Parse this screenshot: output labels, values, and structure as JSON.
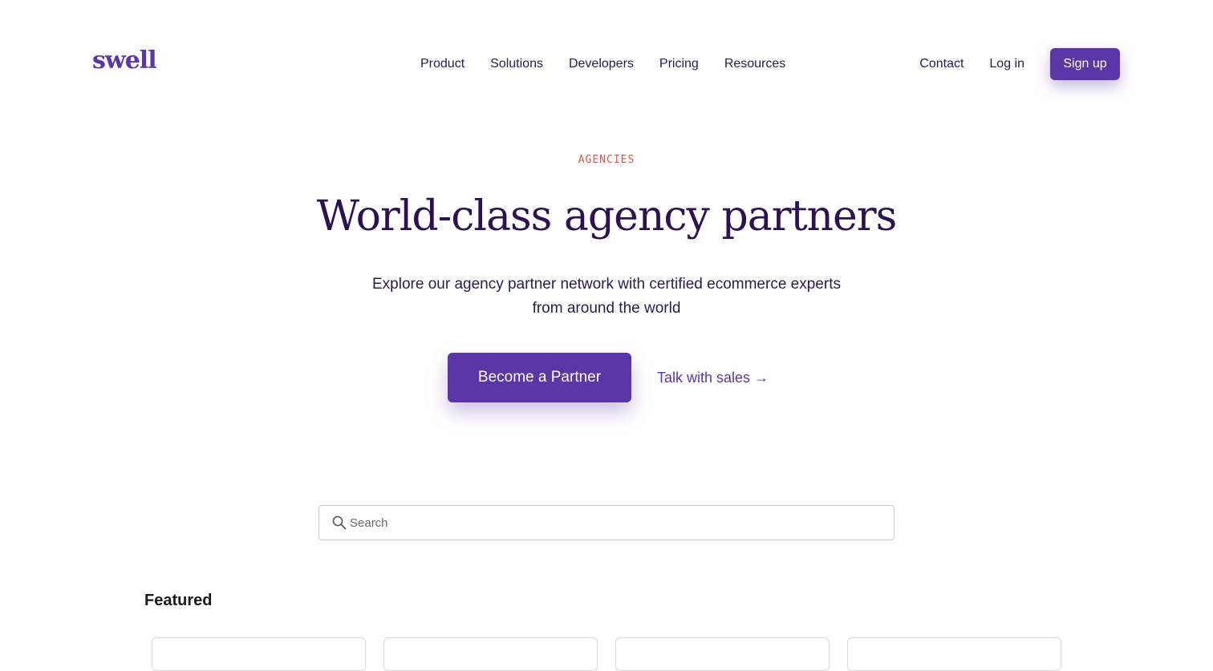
{
  "header": {
    "logo": "swell",
    "nav": [
      "Product",
      "Solutions",
      "Developers",
      "Pricing",
      "Resources"
    ],
    "contact": "Contact",
    "login": "Log in",
    "signup": "Sign up"
  },
  "hero": {
    "eyebrow": "AGENCIES",
    "title": "World-class agency partners",
    "subtitle_line1": "Explore our agency partner network with certified ecommerce experts",
    "subtitle_line2": "from around the world",
    "primary_cta": "Become a Partner",
    "secondary_cta": "Talk with sales →"
  },
  "search": {
    "placeholder": "Search"
  },
  "featured": {
    "title": "Featured"
  },
  "colors": {
    "brand": "#5b36a6",
    "heading": "#2c1250",
    "eyebrow": "#e0554a"
  }
}
